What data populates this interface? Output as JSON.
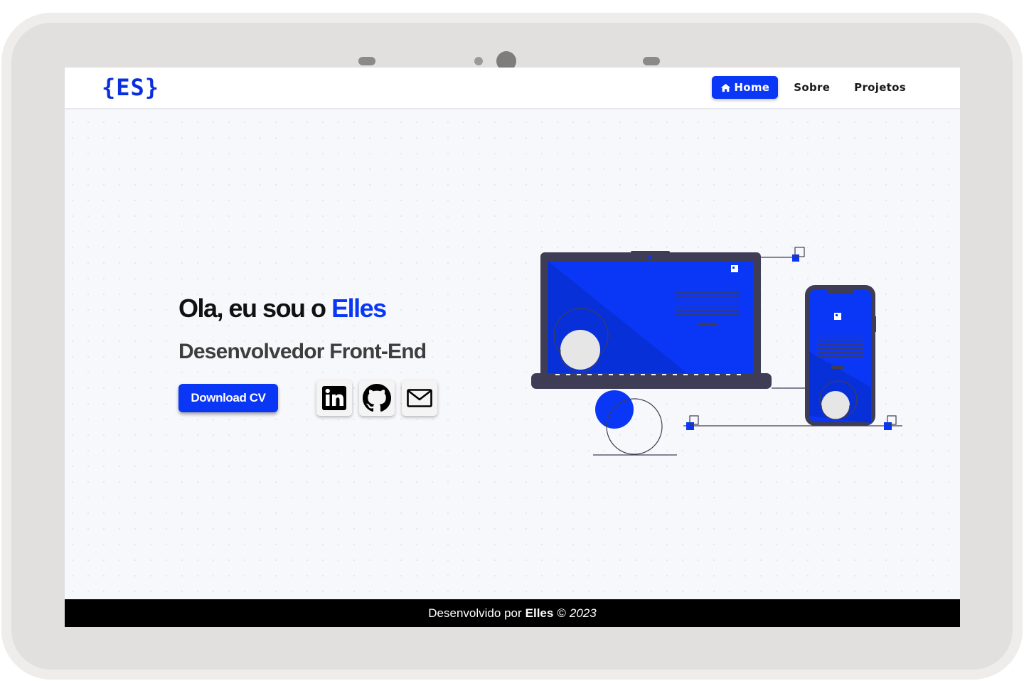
{
  "brand": {
    "logo_text": "{ES}",
    "accent_color": "#0a36f5"
  },
  "nav": {
    "items": [
      {
        "label": "Home",
        "icon": "home-icon",
        "active": true
      },
      {
        "label": "Sobre",
        "active": false
      },
      {
        "label": "Projetos",
        "active": false
      }
    ]
  },
  "hero": {
    "greeting": "Ola, eu sou o",
    "name": "Elles",
    "subtitle": "Desenvolvedor Front-End",
    "download_label": "Download CV",
    "socials": [
      {
        "icon": "linkedin-icon"
      },
      {
        "icon": "github-icon"
      },
      {
        "icon": "mail-icon"
      }
    ],
    "illustration": "laptop-and-phone-illustration"
  },
  "footer": {
    "prefix": "Desenvolvido por",
    "name": "Elles",
    "copyright": "©",
    "year": "2023"
  }
}
